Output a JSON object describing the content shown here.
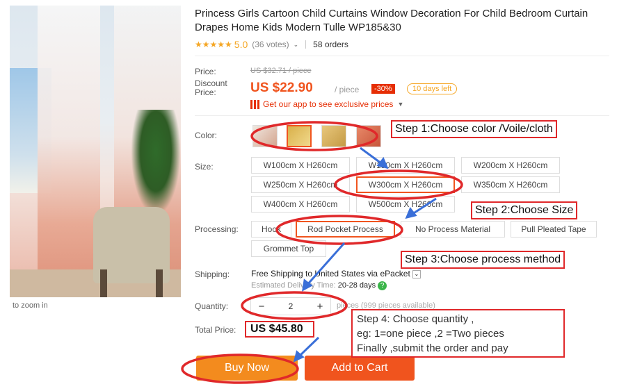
{
  "product": {
    "title": "Princess Girls Cartoon Child Curtains Window Decoration For Child Bedroom Curtain Drapes Home Kids Modern Tulle WP185&30",
    "stars": "★★★★★",
    "rating": "5.0",
    "votes": "(36 votes)",
    "orders": "58 orders",
    "zoom_hint": "to zoom in"
  },
  "price": {
    "price_label": "Price:",
    "old_price": "US $32.71 / piece",
    "discount_label": "Discount Price:",
    "price": "US $22.90",
    "unit": "/ piece",
    "discount": "-30%",
    "days_left": "10 days left",
    "app_promo": "Get our app to see exclusive prices"
  },
  "options": {
    "color_label": "Color:",
    "size_label": "Size:",
    "sizes": [
      "W100cm X H260cm",
      "W150cm X H260cm",
      "W200cm X H260cm",
      "W250cm X H260cm",
      "W300cm X H260cm",
      "W350cm X H260cm",
      "W400cm X H260cm",
      "W500cm X H260cm"
    ],
    "processing_label": "Processing:",
    "processing": [
      "Hook",
      "Rod Pocket Process",
      "No Process Material",
      "Pull Pleated Tape",
      "Grommet Top"
    ]
  },
  "shipping": {
    "label": "Shipping:",
    "text": "Free Shipping to United States via ePacket",
    "eta_label": "Estimated Delivery Time:",
    "eta_value": "20-28 days"
  },
  "quantity": {
    "label": "Quantity:",
    "minus": "−",
    "value": "2",
    "plus": "+",
    "available": "pieces (999 pieces available)"
  },
  "total": {
    "label": "Total Price:",
    "value": "US $45.80"
  },
  "actions": {
    "buy_now": "Buy Now",
    "add_to_cart": "Add to Cart"
  },
  "annotations": {
    "step1": "Step 1:Choose color /Voile/cloth",
    "step2": "Step 2:Choose Size",
    "step3": "Step 3:Choose process method",
    "step4_line1": "Step 4: Choose quantity ,",
    "step4_line2": "eg: 1=one piece ,2 =Two pieces",
    "step4_line3": "Finally ,submit the order and pay",
    "annotation_color": "#e0282a",
    "arrow_color": "#3a6fd8"
  },
  "colors": {
    "accent": "#f0541e",
    "buy_button": "#f38b1e",
    "star": "#f5a623"
  }
}
